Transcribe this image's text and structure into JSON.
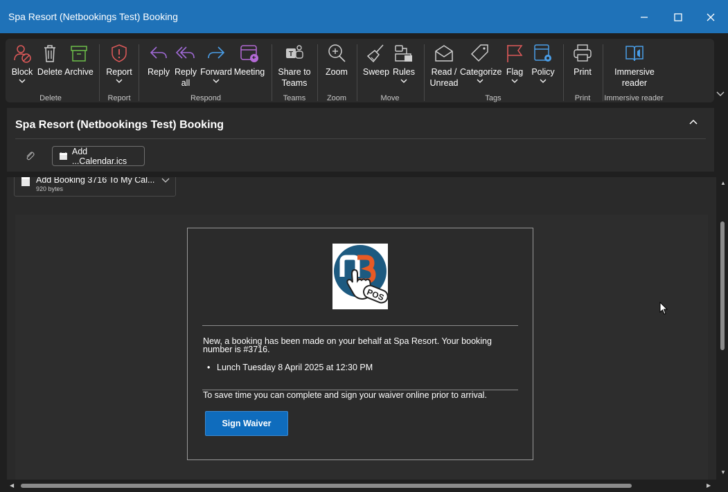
{
  "window": {
    "title": "Spa Resort (Netbookings Test) Booking",
    "controls": [
      "minimize-icon",
      "maximize-icon",
      "close-icon"
    ]
  },
  "ribbon": {
    "buttons": {
      "block": "Block",
      "delete": "Delete",
      "archive": "Archive",
      "report": "Report",
      "reply": "Reply",
      "reply_all_line1": "Reply",
      "reply_all_line2": "all",
      "forward": "Forward",
      "meeting": "Meeting",
      "share_line1": "Share to",
      "share_line2": "Teams",
      "zoom": "Zoom",
      "sweep": "Sweep",
      "rules": "Rules",
      "read_line1": "Read /",
      "read_line2": "Unread",
      "categorize": "Categorize",
      "flag": "Flag",
      "policy": "Policy",
      "print": "Print",
      "immersive_line1": "Immersive",
      "immersive_line2": "reader"
    },
    "groups": {
      "delete": "Delete",
      "report": "Report",
      "respond": "Respond",
      "teams": "Teams",
      "zoom": "Zoom",
      "move": "Move",
      "tags": "Tags",
      "print": "Print",
      "immersive": "Immersive reader"
    }
  },
  "message": {
    "subject": "Spa Resort (Netbookings Test) Booking",
    "attachment_button": "Add ...Calendar.ics",
    "attachment_card": {
      "name": "Add Booking 3716 To My Cal...",
      "size": "920 bytes"
    }
  },
  "email": {
    "logo_text": "POS",
    "intro_line1": "New, a booking has been made on your behalf at Spa Resort. Your booking",
    "intro_line2": "number is #3716.",
    "bullet": "Lunch Tuesday 8 April 2025 at 12:30 PM",
    "waiver_text": "To save time you can complete and sign your waiver online prior to arrival.",
    "sign_button": "Sign Waiver"
  },
  "colors": {
    "titlebar": "#1f72b8",
    "ribbon": "#2b2b2b",
    "accent_button": "#0f6cbd"
  }
}
